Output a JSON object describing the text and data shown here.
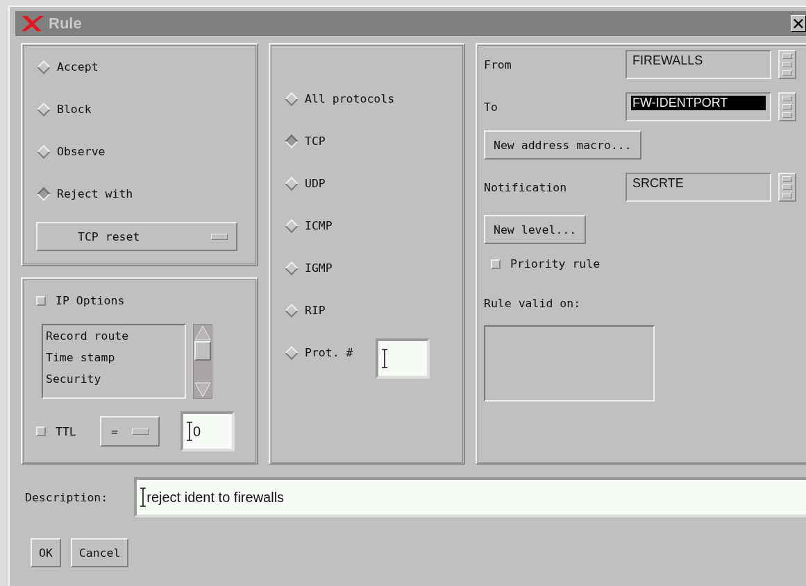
{
  "window": {
    "title": "Rule"
  },
  "action": {
    "options": [
      {
        "label": "Accept",
        "selected": false
      },
      {
        "label": "Block",
        "selected": false
      },
      {
        "label": "Observe",
        "selected": false
      },
      {
        "label": "Reject with",
        "selected": true
      }
    ],
    "reject_type": "TCP reset"
  },
  "ip_options": {
    "label": "IP Options",
    "checked": false,
    "items": [
      "Record route",
      "Time stamp",
      "Security"
    ],
    "ttl": {
      "label": "TTL",
      "checked": false,
      "operator": "=",
      "value": "0"
    }
  },
  "protocols": [
    {
      "kind": "plain",
      "label": "All protocols",
      "selected": false
    },
    {
      "kind": "plain",
      "label": "TCP",
      "selected": true
    },
    {
      "kind": "plain",
      "label": "UDP",
      "selected": false
    },
    {
      "kind": "plain",
      "label": "ICMP",
      "selected": false
    },
    {
      "kind": "plain",
      "label": "IGMP",
      "selected": false
    },
    {
      "kind": "plain",
      "label": "RIP",
      "selected": false
    },
    {
      "kind": "number",
      "label": "Prot. #",
      "selected": false
    }
  ],
  "addresses": [
    {
      "label": "From",
      "value": "FIREWALLS",
      "highlighted": false
    },
    {
      "label": "To",
      "value": "FW-IDENTPORT",
      "highlighted": true
    }
  ],
  "new_address_button": "New address macro...",
  "notification": {
    "label": "Notification",
    "value": "SRCRTE"
  },
  "new_level_button": "New level...",
  "priority": {
    "label": "Priority rule",
    "checked": false
  },
  "valid_on_label": "Rule valid on:",
  "description": {
    "label": "Description:",
    "value": "reject ident to firewalls"
  },
  "buttons": [
    "OK",
    "Cancel"
  ]
}
